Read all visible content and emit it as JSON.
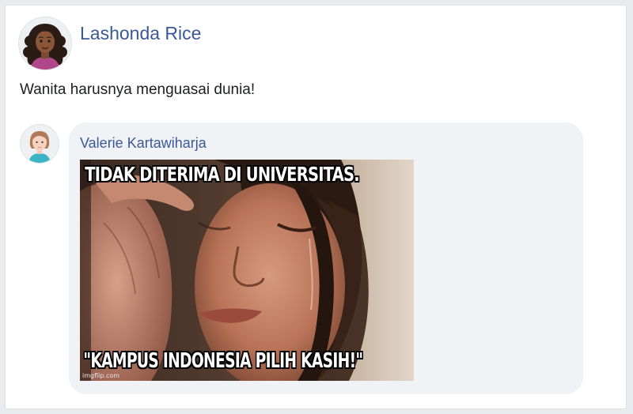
{
  "post": {
    "author": "Lashonda Rice",
    "text": "Wanita harusnya menguasai dunia!"
  },
  "comment": {
    "author": "Valerie Kartawiharja",
    "meme": {
      "top_text": "TIDAK DITERIMA DI UNIVERSITAS.",
      "bottom_text": "\"KAMPUS INDONESIA PILIH KASIH!\"",
      "watermark": "imgflip.com"
    }
  },
  "colors": {
    "author_link": "#3b5998",
    "bubble": "#f0f2f5",
    "card": "#ffffff",
    "page": "#e9ebee"
  }
}
